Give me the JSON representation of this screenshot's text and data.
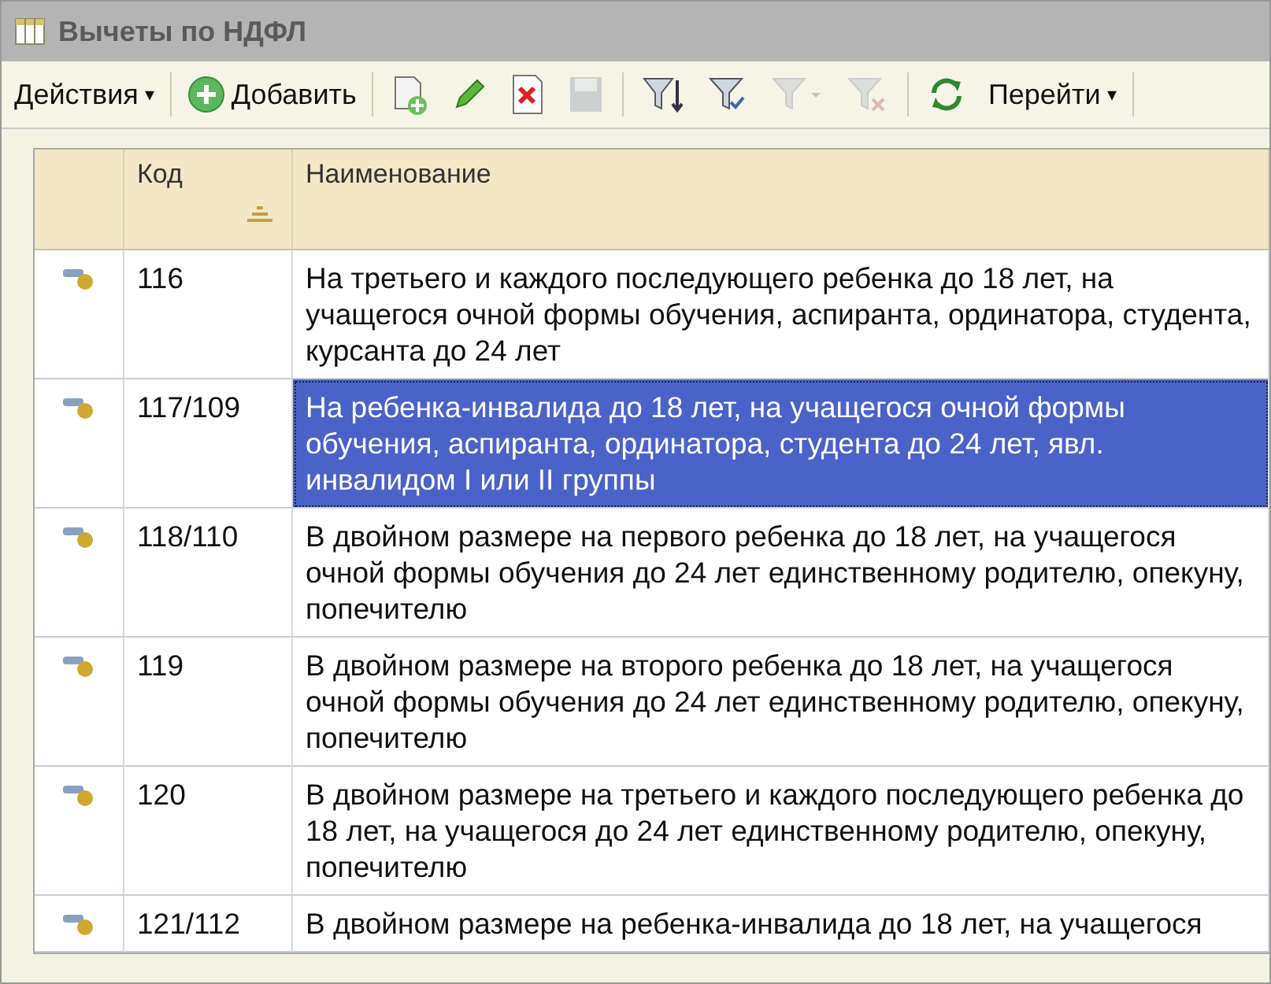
{
  "window": {
    "title": "Вычеты по НДФЛ"
  },
  "toolbar": {
    "actions_menu": {
      "label": "Действия",
      "caret": "▾"
    },
    "add_button": {
      "label": "Добавить"
    },
    "tools": [
      {
        "kind": "copy",
        "disabled": false
      },
      {
        "kind": "edit",
        "disabled": false
      },
      {
        "kind": "delete",
        "disabled": false
      },
      {
        "kind": "save",
        "disabled": true
      },
      {
        "kind": "filter-set",
        "disabled": false
      },
      {
        "kind": "filter",
        "disabled": false
      },
      {
        "kind": "filter-menu",
        "disabled": true
      },
      {
        "kind": "filter-clear",
        "disabled": true
      },
      {
        "kind": "refresh",
        "disabled": false
      }
    ],
    "goto_menu": {
      "label": "Перейти",
      "caret": "▾"
    }
  },
  "table": {
    "columns": [
      {
        "label": "Код",
        "sorted": true
      },
      {
        "label": "Наименование",
        "sorted": false
      }
    ],
    "rows": [
      {
        "code": "116",
        "name": "На третьего и каждого последующего ребенка до 18 лет, на учащегося очной формы обучения, аспиранта, ординатора, студента, курсанта до 24 лет",
        "selected": false
      },
      {
        "code": "117/109",
        "name": "На ребенка-инвалида до 18 лет, на учащегося очной формы обучения, аспиранта, ординатора, студента до 24 лет, явл. инвалидом I или II группы",
        "selected": true
      },
      {
        "code": "118/110",
        "name": "В двойном размере на первого ребенка до 18 лет, на учащегося очной формы обучения до 24 лет единственному родителю, опекуну, попечителю",
        "selected": false
      },
      {
        "code": "119",
        "name": "В двойном размере на второго ребенка до 18 лет, на учащегося очной формы обучения до 24 лет единственному родителю, опекуну, попечителю",
        "selected": false
      },
      {
        "code": "120",
        "name": "В двойном размере на третьего и каждого последующего ребенка до 18 лет,  на учащегося до 24 лет единственному родителю, опекуну, попечителю",
        "selected": false
      },
      {
        "code": "121/112",
        "name": "В двойном размере на ребенка-инвалида до 18 лет, на учащегося",
        "selected": false
      }
    ]
  }
}
